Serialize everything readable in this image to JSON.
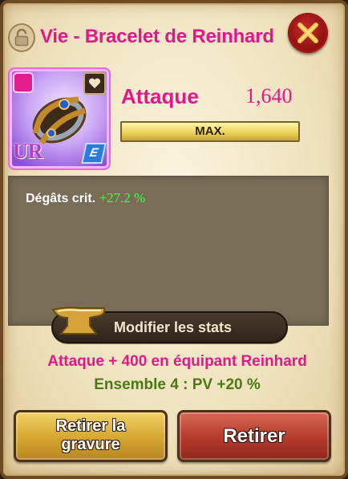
{
  "header": {
    "title": "Vie - Bracelet de Reinhard"
  },
  "item": {
    "icon": "bracelet-icon",
    "rarity_label": "UR",
    "grade_badge": "E",
    "main_stat": {
      "label": "Attaque",
      "value": "1,640"
    },
    "level_bar": "MAX."
  },
  "substats": {
    "crit_label": "Dégâts crit.",
    "crit_value": "+27.2 %"
  },
  "modify_button": "Modifier les stats",
  "bonuses": {
    "character": "Attaque + 400 en équipant Reinhard",
    "set": "Ensemble 4 : PV +20 %"
  },
  "actions": {
    "remove_engraving_line1": "Retirer la",
    "remove_engraving_line2": "gravure",
    "remove": "Retirer"
  },
  "colors": {
    "title": "#e0188c",
    "set_bonus": "#4a7a12",
    "crit_value": "#3cff4a"
  }
}
